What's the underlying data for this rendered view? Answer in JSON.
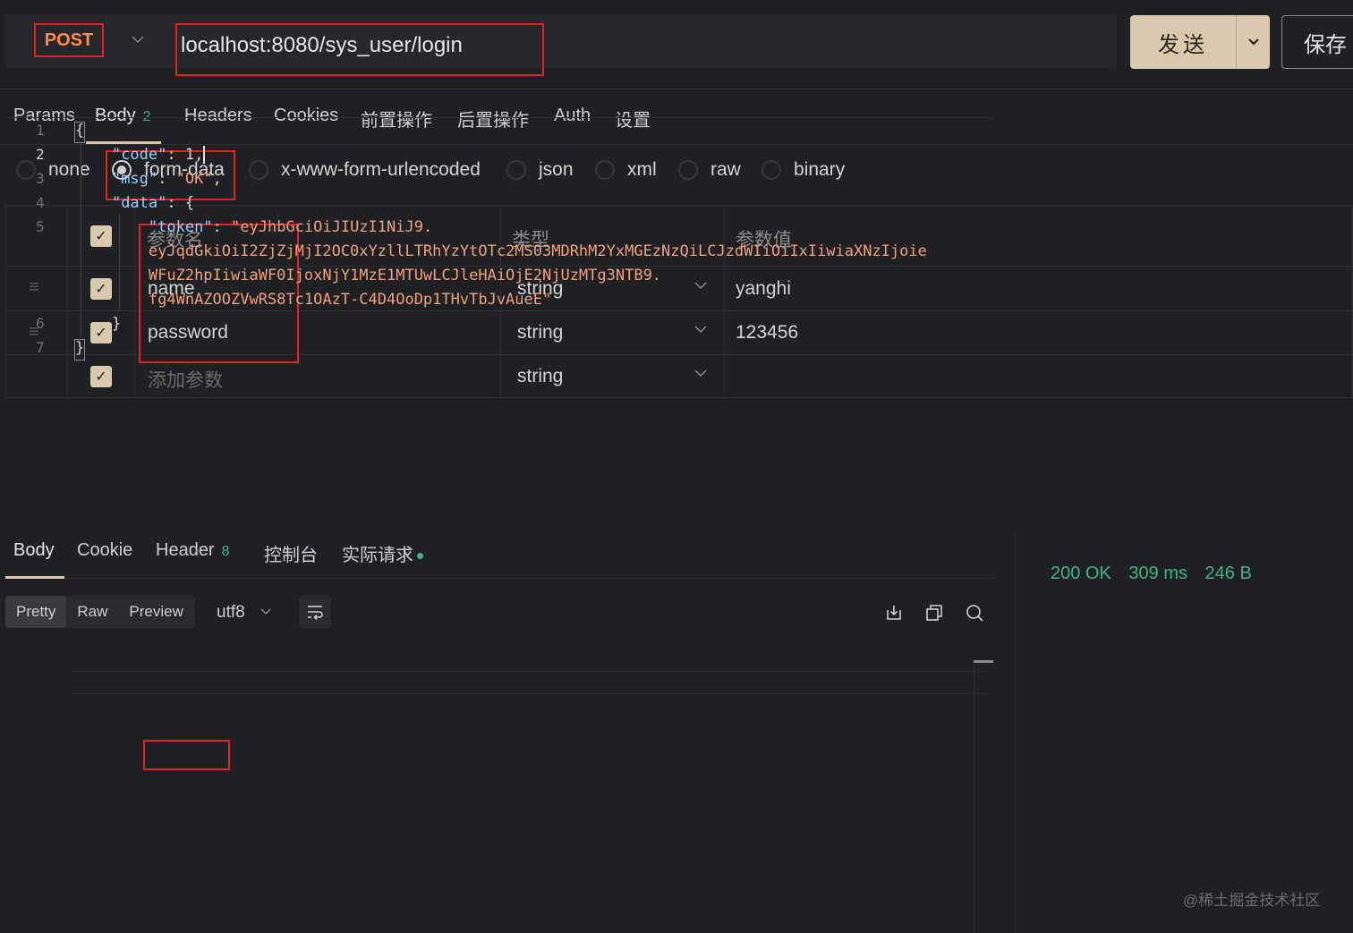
{
  "request": {
    "method": "POST",
    "url": "localhost:8080/sys_user/login",
    "send_label": "发送",
    "save_label": "保存"
  },
  "req_tabs": [
    {
      "label": "Params"
    },
    {
      "label": "Body",
      "count": "2"
    },
    {
      "label": "Headers"
    },
    {
      "label": "Cookies"
    },
    {
      "label": "前置操作"
    },
    {
      "label": "后置操作"
    },
    {
      "label": "Auth"
    },
    {
      "label": "设置"
    }
  ],
  "body_types": [
    "none",
    "form-data",
    "x-www-form-urlencoded",
    "json",
    "xml",
    "raw",
    "binary"
  ],
  "body_type_selected": "form-data",
  "params": {
    "headers": {
      "name": "参数名",
      "type": "类型",
      "value": "参数值"
    },
    "rows": [
      {
        "name": "name",
        "type": "string",
        "value": "yanghi"
      },
      {
        "name": "password",
        "type": "string",
        "value": "123456"
      }
    ],
    "add_row": {
      "placeholder": "添加参数",
      "type": "string"
    }
  },
  "response": {
    "tabs": [
      {
        "label": "Body"
      },
      {
        "label": "Cookie"
      },
      {
        "label": "Header",
        "count": "8"
      },
      {
        "label": "控制台"
      },
      {
        "label": "实际请求"
      }
    ],
    "views": [
      "Pretty",
      "Raw",
      "Preview"
    ],
    "encoding": "utf8",
    "status": {
      "code": "200 OK",
      "time": "309 ms",
      "size": "246 B"
    },
    "line_numbers": [
      "1",
      "2",
      "3",
      "4",
      "5",
      "6",
      "7"
    ],
    "json": {
      "open": "{",
      "code_key": "\"code\"",
      "code_val": "1",
      "msg_key": "\"msg\"",
      "msg_val": "\"OK\"",
      "data_key": "\"data\"",
      "token_key": "\"token\"",
      "token_l1": "\"eyJhbGciOiJIUzI1NiJ9.",
      "token_l2": "eyJqdGkiOiI2ZjZjMjI2OC0xYzllLTRhYzYtOTc2MS03MDRhM2YxMGEzNzQiLCJzdWIiOiIxIiwiaXNzIjoie",
      "token_l3": "WFuZ2hpIiwiaWF0IjoxNjY1MzE1MTUwLCJleHAiOjE2NjUzMTg3NTB9.",
      "token_l4": "fg4WnAZOOZVwRS8Tc1OAzT-C4D4OoDp1THvTbJvAueE\"",
      "inner_close": "}",
      "close": "}"
    }
  },
  "watermark": "@稀土掘金技术社区",
  "colors": {
    "accent": "#d9c9ad",
    "method": "#ff8a4c",
    "status": "#3fb38a",
    "highlight_box": "#e02424"
  }
}
